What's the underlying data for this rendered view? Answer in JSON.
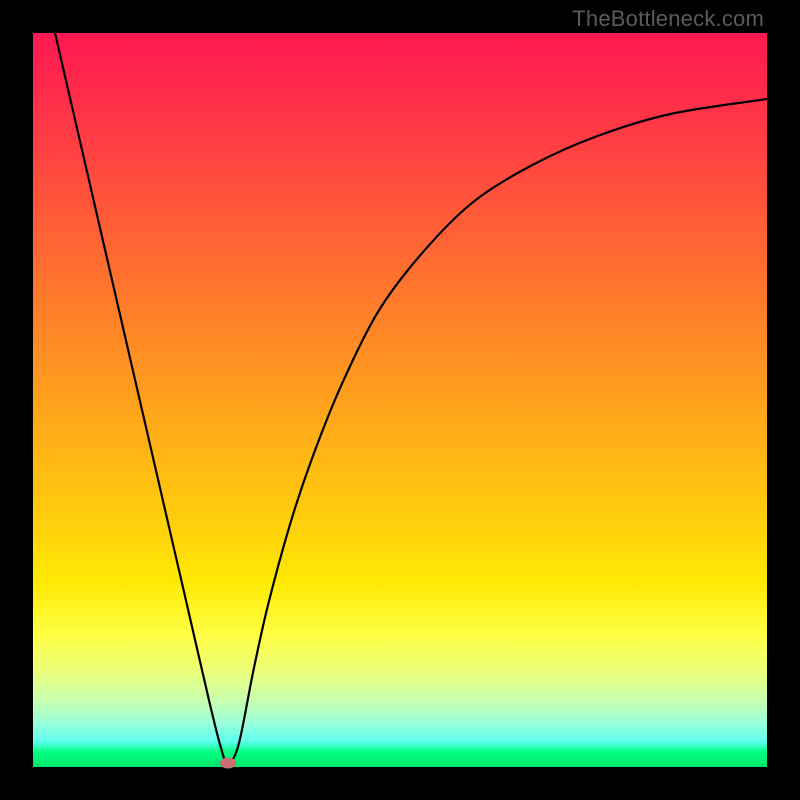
{
  "watermark": "TheBottleneck.com",
  "chart_data": {
    "type": "line",
    "title": "",
    "xlabel": "",
    "ylabel": "",
    "xlim": [
      0,
      100
    ],
    "ylim": [
      0,
      100
    ],
    "series": [
      {
        "name": "curve",
        "x": [
          3,
          6,
          9,
          12,
          15,
          18,
          21,
          24,
          25.5,
          26.5,
          28,
          30,
          32,
          35,
          38,
          42,
          47,
          53,
          60,
          68,
          77,
          87,
          100
        ],
        "values": [
          100,
          87,
          74,
          61,
          48,
          35,
          22,
          9,
          3,
          0.5,
          3,
          13,
          22,
          33,
          42,
          52,
          62,
          70,
          77,
          82,
          86,
          89,
          91
        ]
      }
    ],
    "marker": {
      "x": 26.5,
      "y": 0.5,
      "color": "#cc6f74"
    },
    "background_gradient": {
      "top": "#ff1952",
      "bottom": "#00e56a"
    }
  }
}
